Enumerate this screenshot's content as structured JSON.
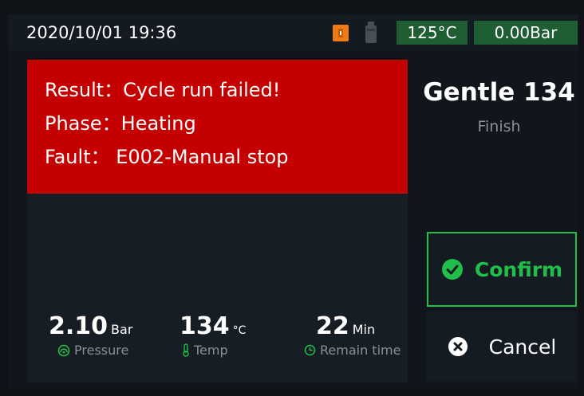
{
  "status_bar": {
    "datetime": "2020/10/01  19:36",
    "icons": [
      "door-open-icon",
      "bottle-icon"
    ],
    "temperature": "125°C",
    "pressure": "0.00Bar"
  },
  "result": {
    "result_line": "Result：Cycle run failed!",
    "phase_line": "Phase：Heating",
    "fault_line": "Fault：  E002-Manual stop"
  },
  "stats": {
    "pressure": {
      "value": "2.10",
      "unit": "Bar",
      "label": "Pressure",
      "icon": "gauge-icon"
    },
    "temp": {
      "value": "134",
      "unit": "°C",
      "label": "Temp",
      "icon": "thermometer-icon"
    },
    "time": {
      "value": "22",
      "unit": "Min",
      "label": "Remain time",
      "icon": "clock-icon"
    }
  },
  "program": {
    "name": "Gentle 134",
    "status": "Finish"
  },
  "actions": {
    "confirm_label": "Confirm",
    "cancel_label": "Cancel"
  },
  "colors": {
    "error_red": "#c40000",
    "accent_green": "#1fbf4a",
    "badge_green": "#1e5e32",
    "door_orange": "#f07a14"
  }
}
